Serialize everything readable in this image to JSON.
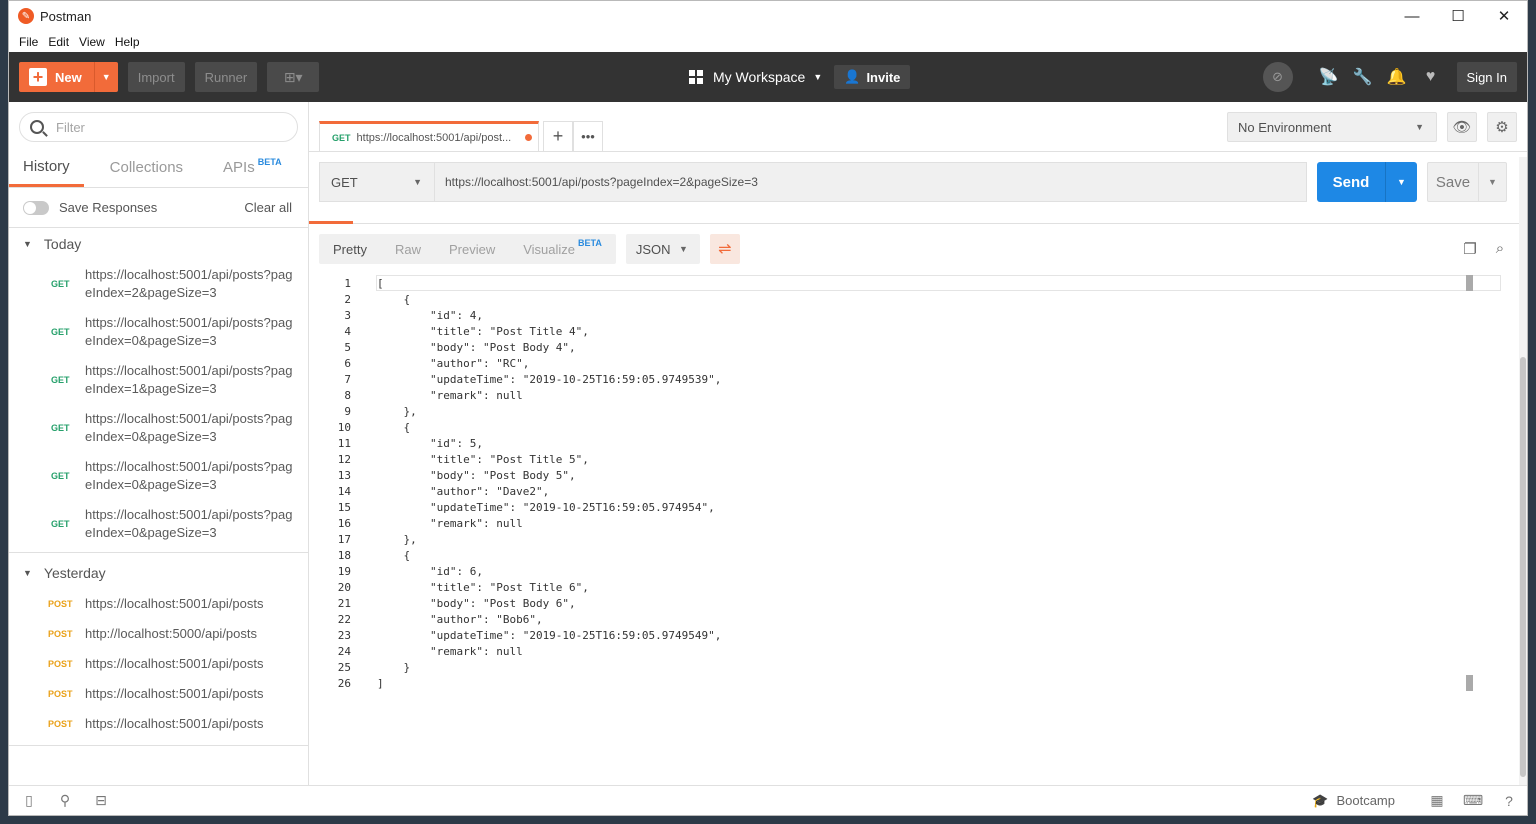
{
  "window": {
    "title": "Postman"
  },
  "menu": [
    "File",
    "Edit",
    "View",
    "Help"
  ],
  "toolbar": {
    "new_label": "New",
    "import_label": "Import",
    "runner_label": "Runner",
    "workspace_label": "My Workspace",
    "invite_label": "Invite",
    "signin_label": "Sign In"
  },
  "sidebar": {
    "filter_placeholder": "Filter",
    "tabs": [
      {
        "label": "History",
        "active": true
      },
      {
        "label": "Collections",
        "active": false
      },
      {
        "label": "APIs",
        "badge": "BETA",
        "active": false
      }
    ],
    "save_responses_label": "Save Responses",
    "clear_all_label": "Clear all",
    "groups": [
      {
        "title": "Today",
        "items": [
          {
            "method": "GET",
            "url": "https://localhost:5001/api/posts?pageIndex=2&pageSize=3"
          },
          {
            "method": "GET",
            "url": "https://localhost:5001/api/posts?pageIndex=0&pageSize=3"
          },
          {
            "method": "GET",
            "url": "https://localhost:5001/api/posts?pageIndex=1&pageSize=3"
          },
          {
            "method": "GET",
            "url": "https://localhost:5001/api/posts?pageIndex=0&pageSize=3"
          },
          {
            "method": "GET",
            "url": "https://localhost:5001/api/posts?pageIndex=0&pageSize=3"
          },
          {
            "method": "GET",
            "url": "https://localhost:5001/api/posts?pageIndex=0&pageSize=3"
          }
        ]
      },
      {
        "title": "Yesterday",
        "items": [
          {
            "method": "POST",
            "url": "https://localhost:5001/api/posts"
          },
          {
            "method": "POST",
            "url": "http://localhost:5000/api/posts"
          },
          {
            "method": "POST",
            "url": "https://localhost:5001/api/posts"
          },
          {
            "method": "POST",
            "url": "https://localhost:5001/api/posts"
          },
          {
            "method": "POST",
            "url": "https://localhost:5001/api/posts"
          }
        ]
      }
    ]
  },
  "request_tab": {
    "method": "GET",
    "title": "https://localhost:5001/api/post..."
  },
  "environment": {
    "selected": "No Environment"
  },
  "request": {
    "method": "GET",
    "url": "https://localhost:5001/api/posts?pageIndex=2&pageSize=3",
    "send_label": "Send",
    "save_label": "Save"
  },
  "response": {
    "views": [
      {
        "label": "Pretty",
        "active": true
      },
      {
        "label": "Raw",
        "active": false
      },
      {
        "label": "Preview",
        "active": false
      },
      {
        "label": "Visualize",
        "badge": "BETA",
        "active": false
      }
    ],
    "format": "JSON",
    "lines": [
      "[",
      "    {",
      "        \"id\": 4,",
      "        \"title\": \"Post Title 4\",",
      "        \"body\": \"Post Body 4\",",
      "        \"author\": \"RC\",",
      "        \"updateTime\": \"2019-10-25T16:59:05.9749539\",",
      "        \"remark\": null",
      "    },",
      "    {",
      "        \"id\": 5,",
      "        \"title\": \"Post Title 5\",",
      "        \"body\": \"Post Body 5\",",
      "        \"author\": \"Dave2\",",
      "        \"updateTime\": \"2019-10-25T16:59:05.974954\",",
      "        \"remark\": null",
      "    },",
      "    {",
      "        \"id\": 6,",
      "        \"title\": \"Post Title 6\",",
      "        \"body\": \"Post Body 6\",",
      "        \"author\": \"Bob6\",",
      "        \"updateTime\": \"2019-10-25T16:59:05.9749549\",",
      "        \"remark\": null",
      "    }",
      "]"
    ]
  },
  "statusbar": {
    "bootcamp_label": "Bootcamp"
  },
  "colors": {
    "accent": "#f26b3a",
    "send": "#1e88e5",
    "toolbar": "#333333",
    "get": "#26a06b",
    "post": "#e9a11a"
  }
}
